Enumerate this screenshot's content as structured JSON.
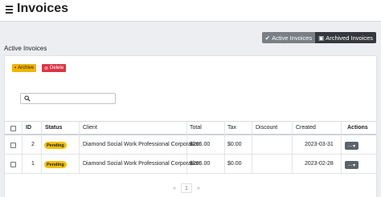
{
  "header": {
    "title": "Invoices"
  },
  "view_toggle": {
    "active_label": "Active Invoices",
    "archived_label": "Archived Invoices"
  },
  "section": {
    "title": "Active Invoices"
  },
  "bulk_actions": {
    "archive_label": "Archive",
    "delete_label": "Delete"
  },
  "search": {
    "placeholder": "",
    "value": ""
  },
  "table": {
    "columns": [
      "ID",
      "Status",
      "Client",
      "Total",
      "Tax",
      "Discount",
      "Created",
      "Actions"
    ],
    "rows": [
      {
        "id": "2",
        "status": "Pending",
        "client": "Diamond Social Work Professional Corporation",
        "total": "$265.00",
        "tax": "$0.00",
        "discount": "",
        "created": "2023-03-31",
        "actions": "..."
      },
      {
        "id": "1",
        "status": "Pending",
        "client": "Diamond Social Work Professional Corporation",
        "total": "$265.00",
        "tax": "$0.00",
        "discount": "",
        "created": "2023-02-28",
        "actions": "..."
      }
    ]
  },
  "pagination": {
    "prev": "«",
    "current": "1",
    "next": "»"
  },
  "colors": {
    "pending": "#f5c000",
    "archive": "#f0b400",
    "delete": "#dc3545",
    "dark": "#35393d"
  }
}
